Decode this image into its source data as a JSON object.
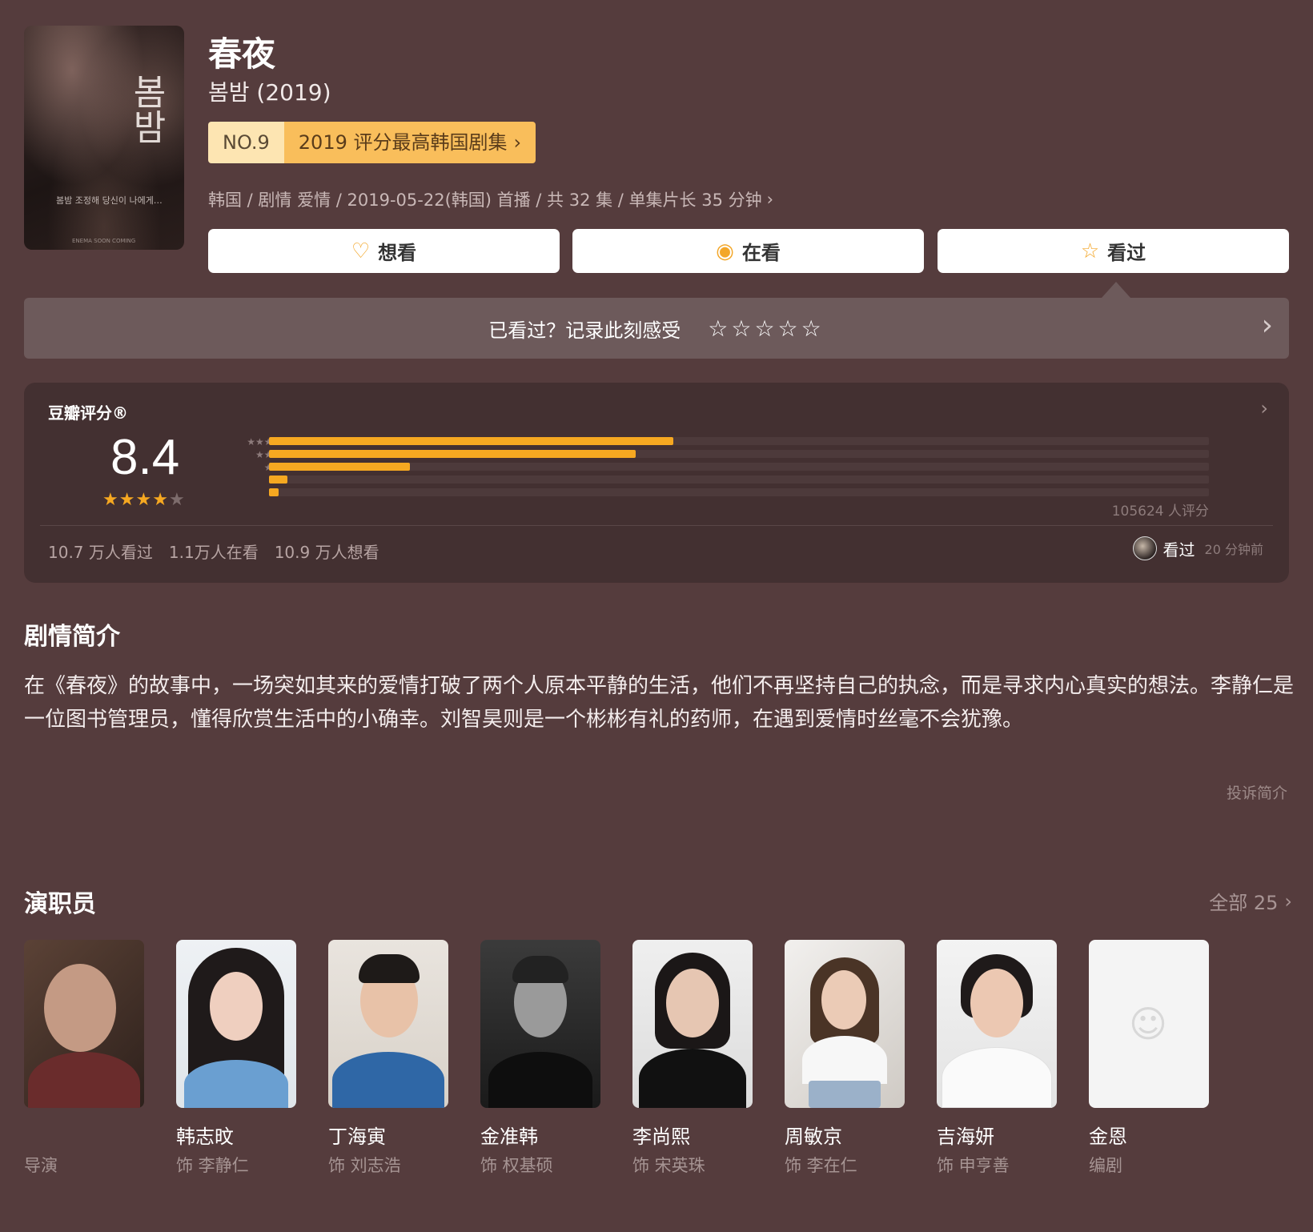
{
  "header": {
    "title": "春夜",
    "subtitle": "봄밤 (2019)",
    "poster": {
      "hangul": "봄밤",
      "small": "봄밤 조정해 당신이 나에게…",
      "tiny": "ENEMA SOON COMING"
    },
    "rank": {
      "no": "NO.9",
      "text": "2019 评分最高韩国剧集"
    },
    "meta": "韩国 / 剧情 爱情 / 2019-05-22(韩国) 首播 / 共 32 集 / 单集片长 35 分钟"
  },
  "actions": {
    "want": {
      "icon": "heart-plus-icon",
      "label": "想看"
    },
    "watching": {
      "icon": "target-icon",
      "label": "在看"
    },
    "watched": {
      "icon": "star-outline-icon",
      "label": "看过"
    }
  },
  "record": {
    "prompt": "已看过？记录此刻感受",
    "stars": "☆☆☆☆☆"
  },
  "rating": {
    "label": "豆瓣评分®",
    "score": "8.4",
    "stars_filled": 4,
    "stars_total": 5,
    "distribution_labels": [
      "★★★★★",
      "★★★★",
      "★★★",
      "★★",
      "★"
    ],
    "distribution_fraction": [
      0.43,
      0.39,
      0.15,
      0.02,
      0.01
    ],
    "count_text": "105624 人评分",
    "stats": [
      "10.7 万人看过",
      "1.1万人在看",
      "10.9 万人想看"
    ],
    "user_action": "看过",
    "user_time": "20 分钟前",
    "accent_color": "#f6a821"
  },
  "synopsis": {
    "title": "剧情简介",
    "text": "在《春夜》的故事中，一场突如其来的爱情打破了两个人原本平静的生活，他们不再坚持自己的执念，而是寻求内心真实的想法。李静仁是一位图书管理员，懂得欣赏生活中的小确幸。刘智昊则是一个彬彬有礼的药师，在遇到爱情时丝毫不会犹豫。",
    "report": "投诉简介"
  },
  "cast": {
    "title": "演职员",
    "all_label": "全部 25",
    "members": [
      {
        "name": "",
        "role": "导演"
      },
      {
        "name": "韩志旼",
        "role": "饰 李静仁"
      },
      {
        "name": "丁海寅",
        "role": "饰 刘志浩"
      },
      {
        "name": "金准韩",
        "role": "饰 权基硕"
      },
      {
        "name": "李尚熙",
        "role": "饰 宋英珠"
      },
      {
        "name": "周敏京",
        "role": "饰 李在仁"
      },
      {
        "name": "吉海妍",
        "role": "饰 申亨善"
      },
      {
        "name": "金恩",
        "role": "编剧"
      }
    ]
  },
  "colors": {
    "background": "#553c3d",
    "card": "#433031",
    "accent": "#f6a821"
  }
}
